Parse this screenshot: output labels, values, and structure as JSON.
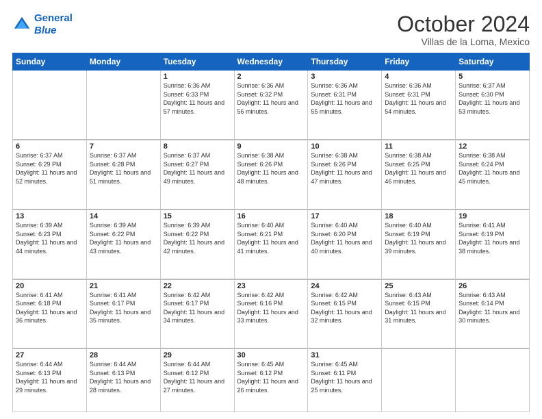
{
  "header": {
    "logo_line1": "General",
    "logo_line2": "Blue",
    "title": "October 2024",
    "subtitle": "Villas de la Loma, Mexico"
  },
  "weekdays": [
    "Sunday",
    "Monday",
    "Tuesday",
    "Wednesday",
    "Thursday",
    "Friday",
    "Saturday"
  ],
  "weeks": [
    [
      {
        "day": "",
        "info": ""
      },
      {
        "day": "",
        "info": ""
      },
      {
        "day": "1",
        "info": "Sunrise: 6:36 AM\nSunset: 6:33 PM\nDaylight: 11 hours and 57 minutes."
      },
      {
        "day": "2",
        "info": "Sunrise: 6:36 AM\nSunset: 6:32 PM\nDaylight: 11 hours and 56 minutes."
      },
      {
        "day": "3",
        "info": "Sunrise: 6:36 AM\nSunset: 6:31 PM\nDaylight: 11 hours and 55 minutes."
      },
      {
        "day": "4",
        "info": "Sunrise: 6:36 AM\nSunset: 6:31 PM\nDaylight: 11 hours and 54 minutes."
      },
      {
        "day": "5",
        "info": "Sunrise: 6:37 AM\nSunset: 6:30 PM\nDaylight: 11 hours and 53 minutes."
      }
    ],
    [
      {
        "day": "6",
        "info": "Sunrise: 6:37 AM\nSunset: 6:29 PM\nDaylight: 11 hours and 52 minutes."
      },
      {
        "day": "7",
        "info": "Sunrise: 6:37 AM\nSunset: 6:28 PM\nDaylight: 11 hours and 51 minutes."
      },
      {
        "day": "8",
        "info": "Sunrise: 6:37 AM\nSunset: 6:27 PM\nDaylight: 11 hours and 49 minutes."
      },
      {
        "day": "9",
        "info": "Sunrise: 6:38 AM\nSunset: 6:26 PM\nDaylight: 11 hours and 48 minutes."
      },
      {
        "day": "10",
        "info": "Sunrise: 6:38 AM\nSunset: 6:26 PM\nDaylight: 11 hours and 47 minutes."
      },
      {
        "day": "11",
        "info": "Sunrise: 6:38 AM\nSunset: 6:25 PM\nDaylight: 11 hours and 46 minutes."
      },
      {
        "day": "12",
        "info": "Sunrise: 6:38 AM\nSunset: 6:24 PM\nDaylight: 11 hours and 45 minutes."
      }
    ],
    [
      {
        "day": "13",
        "info": "Sunrise: 6:39 AM\nSunset: 6:23 PM\nDaylight: 11 hours and 44 minutes."
      },
      {
        "day": "14",
        "info": "Sunrise: 6:39 AM\nSunset: 6:22 PM\nDaylight: 11 hours and 43 minutes."
      },
      {
        "day": "15",
        "info": "Sunrise: 6:39 AM\nSunset: 6:22 PM\nDaylight: 11 hours and 42 minutes."
      },
      {
        "day": "16",
        "info": "Sunrise: 6:40 AM\nSunset: 6:21 PM\nDaylight: 11 hours and 41 minutes."
      },
      {
        "day": "17",
        "info": "Sunrise: 6:40 AM\nSunset: 6:20 PM\nDaylight: 11 hours and 40 minutes."
      },
      {
        "day": "18",
        "info": "Sunrise: 6:40 AM\nSunset: 6:19 PM\nDaylight: 11 hours and 39 minutes."
      },
      {
        "day": "19",
        "info": "Sunrise: 6:41 AM\nSunset: 6:19 PM\nDaylight: 11 hours and 38 minutes."
      }
    ],
    [
      {
        "day": "20",
        "info": "Sunrise: 6:41 AM\nSunset: 6:18 PM\nDaylight: 11 hours and 36 minutes."
      },
      {
        "day": "21",
        "info": "Sunrise: 6:41 AM\nSunset: 6:17 PM\nDaylight: 11 hours and 35 minutes."
      },
      {
        "day": "22",
        "info": "Sunrise: 6:42 AM\nSunset: 6:17 PM\nDaylight: 11 hours and 34 minutes."
      },
      {
        "day": "23",
        "info": "Sunrise: 6:42 AM\nSunset: 6:16 PM\nDaylight: 11 hours and 33 minutes."
      },
      {
        "day": "24",
        "info": "Sunrise: 6:42 AM\nSunset: 6:15 PM\nDaylight: 11 hours and 32 minutes."
      },
      {
        "day": "25",
        "info": "Sunrise: 6:43 AM\nSunset: 6:15 PM\nDaylight: 11 hours and 31 minutes."
      },
      {
        "day": "26",
        "info": "Sunrise: 6:43 AM\nSunset: 6:14 PM\nDaylight: 11 hours and 30 minutes."
      }
    ],
    [
      {
        "day": "27",
        "info": "Sunrise: 6:44 AM\nSunset: 6:13 PM\nDaylight: 11 hours and 29 minutes."
      },
      {
        "day": "28",
        "info": "Sunrise: 6:44 AM\nSunset: 6:13 PM\nDaylight: 11 hours and 28 minutes."
      },
      {
        "day": "29",
        "info": "Sunrise: 6:44 AM\nSunset: 6:12 PM\nDaylight: 11 hours and 27 minutes."
      },
      {
        "day": "30",
        "info": "Sunrise: 6:45 AM\nSunset: 6:12 PM\nDaylight: 11 hours and 26 minutes."
      },
      {
        "day": "31",
        "info": "Sunrise: 6:45 AM\nSunset: 6:11 PM\nDaylight: 11 hours and 25 minutes."
      },
      {
        "day": "",
        "info": ""
      },
      {
        "day": "",
        "info": ""
      }
    ]
  ]
}
